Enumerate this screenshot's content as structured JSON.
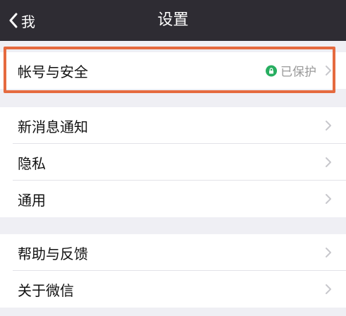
{
  "navbar": {
    "back_label": "我",
    "title": "设置",
    "background": "#2e2c33"
  },
  "groups": [
    {
      "items": [
        {
          "label": "帐号与安全",
          "status": "已保护",
          "status_icon": "lock-icon"
        }
      ]
    },
    {
      "items": [
        {
          "label": "新消息通知"
        },
        {
          "label": "隐私"
        },
        {
          "label": "通用"
        }
      ]
    },
    {
      "items": [
        {
          "label": "帮助与反馈"
        },
        {
          "label": "关于微信"
        }
      ]
    }
  ],
  "colors": {
    "highlight_border": "#e56a3f",
    "protected_badge": "#27ae60",
    "background": "#efeff4"
  }
}
